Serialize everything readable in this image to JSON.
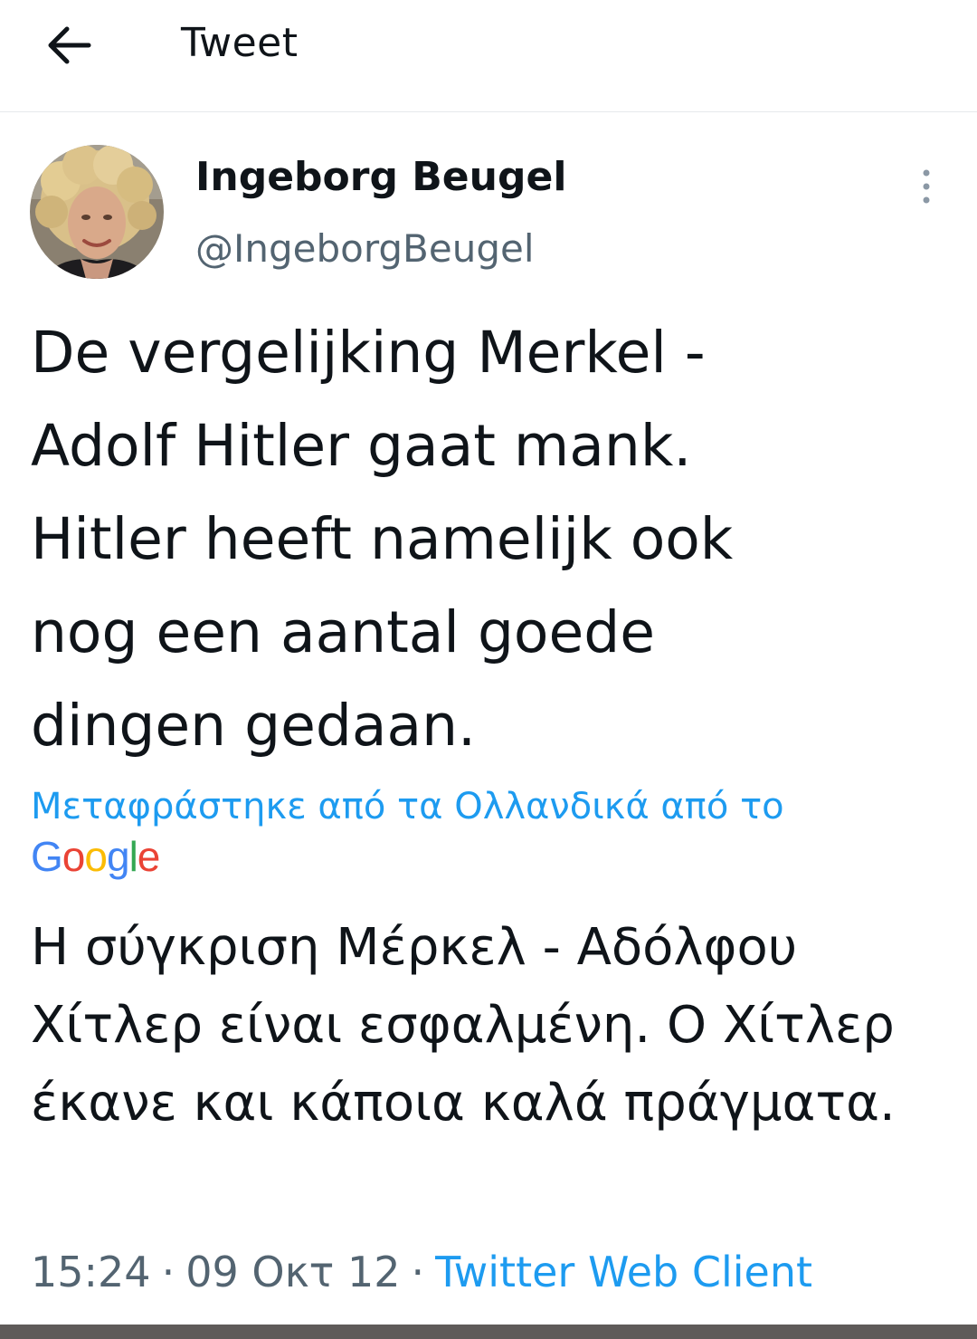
{
  "header": {
    "back_icon": "arrow-left-icon",
    "title": "Tweet"
  },
  "author": {
    "display_name": "Ingeborg Beugel",
    "handle": "@IngeborgBeugel",
    "more_icon": "more-vertical-icon"
  },
  "tweet": {
    "text": "De vergelijking Merkel -\nAdolf Hitler gaat mank.\nHitler heeft namelijk ook\nnog een aantal goede\ndingen gedaan."
  },
  "translation": {
    "attribution": "Μεταφράστηκε από τα Ολλανδικά από το",
    "provider_logo": "Google",
    "text": "Η σύγκριση Μέρκελ - Αδόλφου Χίτλερ είναι εσφαλμένη. Ο Χίτλερ έκανε και κάποια καλά πράγματα."
  },
  "meta": {
    "time": "15:24",
    "separator": "·",
    "date": "09 Οκτ 12",
    "source": "Twitter Web Client"
  },
  "colors": {
    "link": "#1d9bf0",
    "secondary_text": "#536471",
    "primary_text": "#0f1419",
    "google_blue": "#4285f4",
    "google_red": "#ea4335",
    "google_yellow": "#fbbc05",
    "google_green": "#34a853"
  }
}
